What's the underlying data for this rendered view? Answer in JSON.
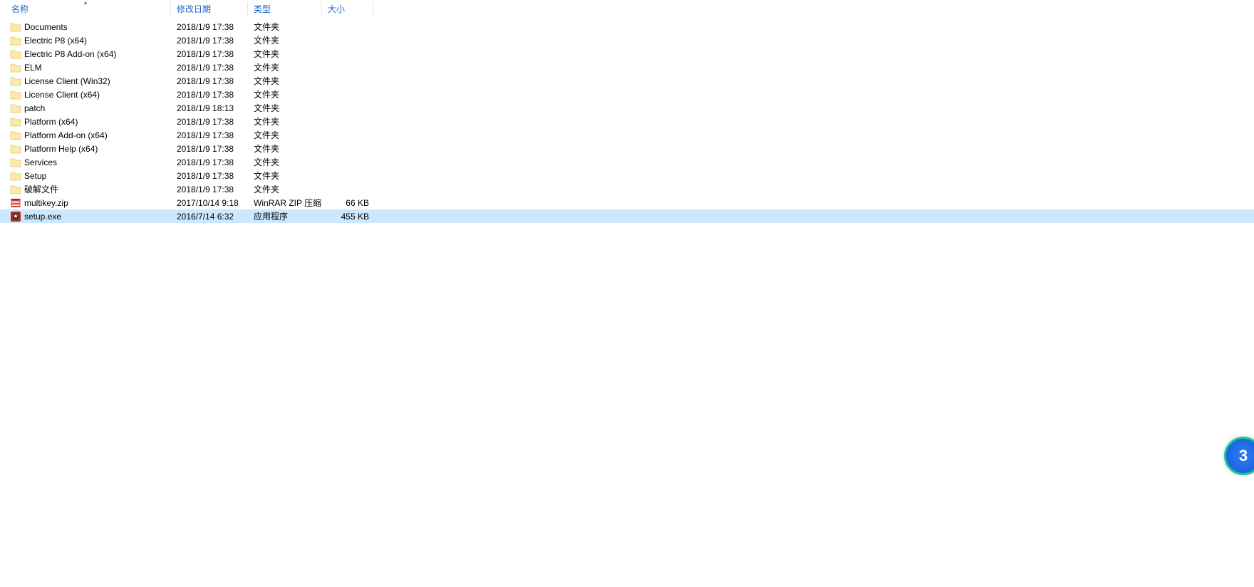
{
  "columns": {
    "name": "名称",
    "date": "修改日期",
    "type": "类型",
    "size": "大小"
  },
  "sort": {
    "column": "name",
    "direction": "asc"
  },
  "items": [
    {
      "icon": "folder",
      "name": "Documents",
      "date": "2018/1/9 17:38",
      "type": "文件夹",
      "size": "",
      "selected": false
    },
    {
      "icon": "folder",
      "name": "Electric P8 (x64)",
      "date": "2018/1/9 17:38",
      "type": "文件夹",
      "size": "",
      "selected": false
    },
    {
      "icon": "folder",
      "name": "Electric P8 Add-on (x64)",
      "date": "2018/1/9 17:38",
      "type": "文件夹",
      "size": "",
      "selected": false
    },
    {
      "icon": "folder",
      "name": "ELM",
      "date": "2018/1/9 17:38",
      "type": "文件夹",
      "size": "",
      "selected": false
    },
    {
      "icon": "folder",
      "name": "License Client (Win32)",
      "date": "2018/1/9 17:38",
      "type": "文件夹",
      "size": "",
      "selected": false
    },
    {
      "icon": "folder",
      "name": "License Client (x64)",
      "date": "2018/1/9 17:38",
      "type": "文件夹",
      "size": "",
      "selected": false
    },
    {
      "icon": "folder",
      "name": "patch",
      "date": "2018/1/9 18:13",
      "type": "文件夹",
      "size": "",
      "selected": false
    },
    {
      "icon": "folder",
      "name": "Platform (x64)",
      "date": "2018/1/9 17:38",
      "type": "文件夹",
      "size": "",
      "selected": false
    },
    {
      "icon": "folder",
      "name": "Platform Add-on (x64)",
      "date": "2018/1/9 17:38",
      "type": "文件夹",
      "size": "",
      "selected": false
    },
    {
      "icon": "folder",
      "name": "Platform Help (x64)",
      "date": "2018/1/9 17:38",
      "type": "文件夹",
      "size": "",
      "selected": false
    },
    {
      "icon": "folder",
      "name": "Services",
      "date": "2018/1/9 17:38",
      "type": "文件夹",
      "size": "",
      "selected": false
    },
    {
      "icon": "folder",
      "name": "Setup",
      "date": "2018/1/9 17:38",
      "type": "文件夹",
      "size": "",
      "selected": false
    },
    {
      "icon": "folder",
      "name": "破解文件",
      "date": "2018/1/9 17:38",
      "type": "文件夹",
      "size": "",
      "selected": false
    },
    {
      "icon": "zip",
      "name": "multikey.zip",
      "date": "2017/10/14 9:18",
      "type": "WinRAR ZIP 压缩...",
      "size": "66 KB",
      "selected": false
    },
    {
      "icon": "exe",
      "name": "setup.exe",
      "date": "2016/7/14 6:32",
      "type": "应用程序",
      "size": "455 KB",
      "selected": true
    }
  ],
  "badge": {
    "text": "3"
  }
}
